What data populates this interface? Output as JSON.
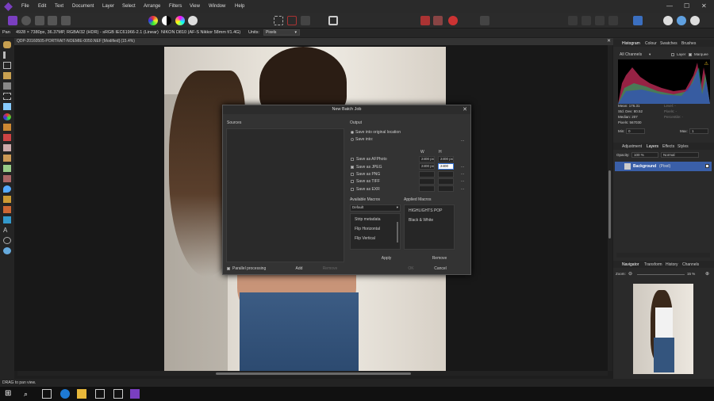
{
  "menubar": {
    "items": [
      "File",
      "Edit",
      "Text",
      "Document",
      "Layer",
      "Select",
      "Arrange",
      "Filters",
      "View",
      "Window",
      "Help"
    ]
  },
  "context": {
    "tool": "Pan",
    "info": "4928 × 7380px, 36.37MP, RGBA/32 (HDR) - sRGB IEC61966-2.1 (Linear)",
    "camera": "NIKON D810 (AF-S Nikkor 58mm f/1.4G)",
    "units_label": "Units:",
    "units_value": "Pixels"
  },
  "document": {
    "tab": "QDP-20160505-PORTRAIT-NOEMIE-0050.NEF [Modified] (15.4%)"
  },
  "panel_top": {
    "tabs": [
      "Histogram",
      "Colour",
      "Swatches",
      "Brushes"
    ],
    "channels": "All Channels",
    "layer_label": "Layer",
    "marquee_label": "Marquee",
    "stats_left": [
      "Mean: 176.31",
      "Std. Dev: 80.52",
      "Median: 207",
      "Pixels: 567030"
    ],
    "stats_right": [
      "Level: -",
      "Pixels: -",
      "Percentile: -"
    ],
    "min_label": "Min:",
    "min_value": "0",
    "max_label": "Max:",
    "max_value": "1"
  },
  "panel_mid": {
    "tabs": [
      "Adjustment",
      "Layers",
      "Effects",
      "Styles"
    ],
    "opacity_label": "Opacity:",
    "opacity_value": "100 %",
    "blend": "Normal",
    "layer_name": "Background",
    "layer_type": "(Pixel)"
  },
  "panel_bot": {
    "tabs": [
      "Navigator",
      "Transform",
      "History",
      "Channels"
    ],
    "zoom_label": "Zoom:",
    "zoom_value": "15 %"
  },
  "status": {
    "text": "DRAG to pan view."
  },
  "dialog": {
    "title": "New Batch Job",
    "sources_label": "Sources",
    "output_label": "Output",
    "save_original": "Save into original location",
    "save_into": "Save into:",
    "w_label": "W",
    "h_label": "H",
    "formats": [
      {
        "label": "Save as AFPhoto",
        "checked": false,
        "w": "2400 px",
        "h": "2400 px"
      },
      {
        "label": "Save as JPEG",
        "checked": true,
        "w": "2400 px",
        "h": "2400"
      },
      {
        "label": "Save as PNG",
        "checked": false,
        "w": "",
        "h": ""
      },
      {
        "label": "Save as TIFF",
        "checked": false,
        "w": "",
        "h": ""
      },
      {
        "label": "Save as EXR",
        "checked": false,
        "w": "",
        "h": ""
      }
    ],
    "available_macros_label": "Available Macros",
    "applied_macros_label": "Applied Macros",
    "macro_category": "Default",
    "available": [
      "Strip metadata",
      "Flip Horizontal",
      "Flip Vertical"
    ],
    "applied": [
      "HIGHLIGHTS POP",
      "Black & White"
    ],
    "apply": "Apply",
    "remove_macro": "Remove",
    "parallel": "Parallel processing",
    "add": "Add",
    "remove": "Remove",
    "ok": "OK",
    "cancel": "Cancel",
    "ellipsis": "..."
  }
}
